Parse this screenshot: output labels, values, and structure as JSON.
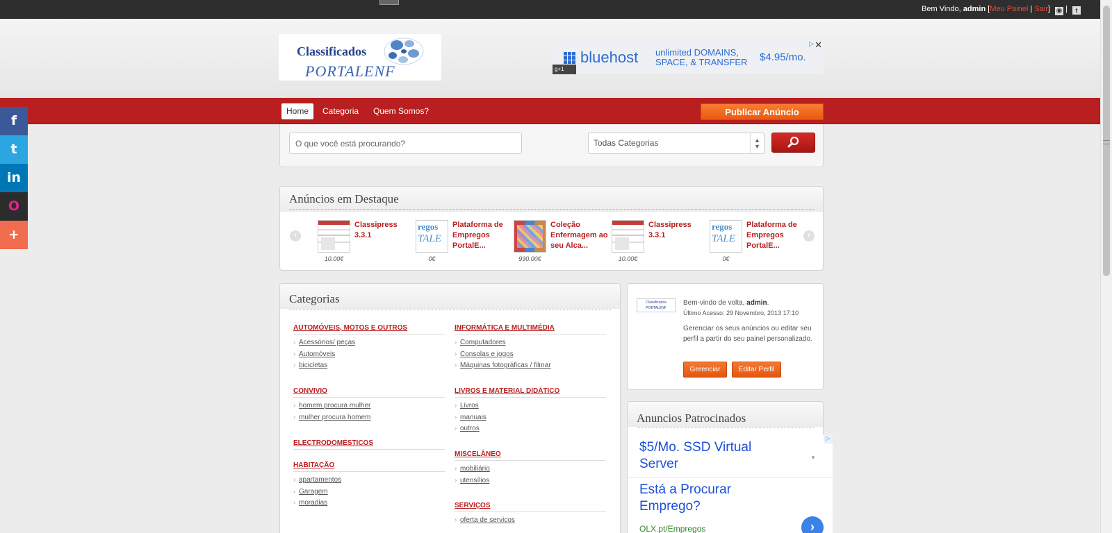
{
  "topbar": {
    "welcome_prefix": "Bem Vindo,",
    "user": "admin",
    "open_bracket": "[",
    "my_panel": "Meu Painel",
    "sep": "|",
    "logout": "Sair",
    "close_bracket": "]",
    "rss_icon": "rss-icon",
    "twitter_icon": "twitter-icon"
  },
  "logo": {
    "line1": "Classificados",
    "line2": "PORTALENF"
  },
  "banner_ad": {
    "brand": "bluehost",
    "tagline_1": "unlimited DOMAINS,",
    "tagline_2": "SPACE, & TRANSFER",
    "price": "$4.95/mo.",
    "gplus": "g+1",
    "close": "✕"
  },
  "nav": {
    "items": [
      {
        "label": "Home"
      },
      {
        "label": "Categoria"
      },
      {
        "label": "Quem Somos?"
      }
    ],
    "publish": "Publicar Anúncio"
  },
  "social": {
    "facebook": "f",
    "twitter": "t",
    "linkedin": "in",
    "other": "O",
    "add": "+"
  },
  "search": {
    "placeholder": "O que você está procurando?",
    "category": "Todas Categorias"
  },
  "featured": {
    "title": "Anúncios em Destaque",
    "items": [
      {
        "name": "Classipress 3.3.1",
        "price": "10.00€"
      },
      {
        "name": "Plataforma de Empregos PortalE...",
        "price": "0€"
      },
      {
        "name": "Coleção Enfermagem ao seu Alca...",
        "price": "990.00€"
      },
      {
        "name": "Classipress 3.3.1",
        "price": "10.00€"
      },
      {
        "name": "Plataforma de Empregos PortalE...",
        "price": "0€"
      }
    ],
    "thumb_text_1": "regos",
    "thumb_text_2": "TALE"
  },
  "categories": {
    "title": "Categorias",
    "left": [
      {
        "name": "AUTOMÓVEIS, MOTOS E OUTROS",
        "subs": [
          "Acessórios/ peças",
          "Automóveis",
          "bicicletas"
        ]
      },
      {
        "name": "CONVIVIO",
        "subs": [
          "homem procura mulher",
          "mulher procura homem"
        ]
      },
      {
        "name": "ELECTRODOMÉSTICOS",
        "subs": []
      },
      {
        "name": "HABITAÇÃO",
        "subs": [
          "apartamentos",
          "Garagem",
          "moradias"
        ]
      }
    ],
    "right": [
      {
        "name": "INFORMÁTICA E MULTIMÉDIA",
        "subs": [
          "Computadores",
          "Consolas e jogos",
          "Máquinas fotográficas / filmar"
        ]
      },
      {
        "name": "LIVROS E MATERIAL DIDÁTICO",
        "subs": [
          "Livros",
          "manuais",
          "outros"
        ]
      },
      {
        "name": "MISCELÂNEO",
        "subs": [
          "mobiliário",
          "utensílios"
        ]
      },
      {
        "name": "SERVIÇOS",
        "subs": [
          "oferta de serviços"
        ]
      }
    ]
  },
  "welcome_box": {
    "greeting": "Bem-vindo de volta,",
    "user": "admin",
    "last_access": "Último Acesso: 29 Novembro, 2013 17:10",
    "desc": "Gerenciar os seus anúncios ou editar seu perfil a partir do seu painel personalizado.",
    "manage": "Gerenciar",
    "edit": "Editar Perfil"
  },
  "sponsored": {
    "title": "Anuncios Patrocinados",
    "ad1": "$5/Mo. SSD Virtual Server",
    "ad2": "Está a Procurar Emprego?",
    "url": "OLX.pt/Empregos"
  }
}
